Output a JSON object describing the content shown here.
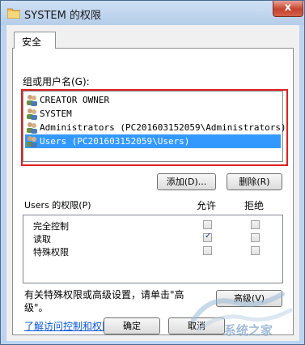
{
  "window": {
    "title": "SYSTEM 的权限",
    "close_glyph": "x"
  },
  "tabs": [
    {
      "label": "安全"
    }
  ],
  "security": {
    "group_label": "组或用户名(G):",
    "users": [
      {
        "name": "CREATOR OWNER",
        "selected": false
      },
      {
        "name": "SYSTEM",
        "selected": false
      },
      {
        "name": "Administrators (PC201603152059\\Administrators)",
        "selected": false
      },
      {
        "name": "Users (PC201603152059\\Users)",
        "selected": true
      }
    ],
    "add_button": "添加(D)...",
    "remove_button": "删除(R)",
    "permissions_header": "Users 的权限(P)",
    "allow_header": "允许",
    "deny_header": "拒绝",
    "permissions": [
      {
        "label": "完全控制",
        "allow": false,
        "deny": false
      },
      {
        "label": "读取",
        "allow": true,
        "deny": false
      },
      {
        "label": "特殊权限",
        "allow": false,
        "deny": false
      }
    ],
    "special_note": "有关特殊权限或高级设置，请单击\"高级\"。",
    "advanced_button": "高级(V)",
    "learn_link": "了解访问控制和权限"
  },
  "footer": {
    "ok_button": "确定",
    "cancel_button": "取消"
  },
  "watermark": {
    "text": "系统之家"
  },
  "colors": {
    "selection": "#3399ff",
    "highlight_border": "#e02020",
    "link": "#0a56d8"
  }
}
